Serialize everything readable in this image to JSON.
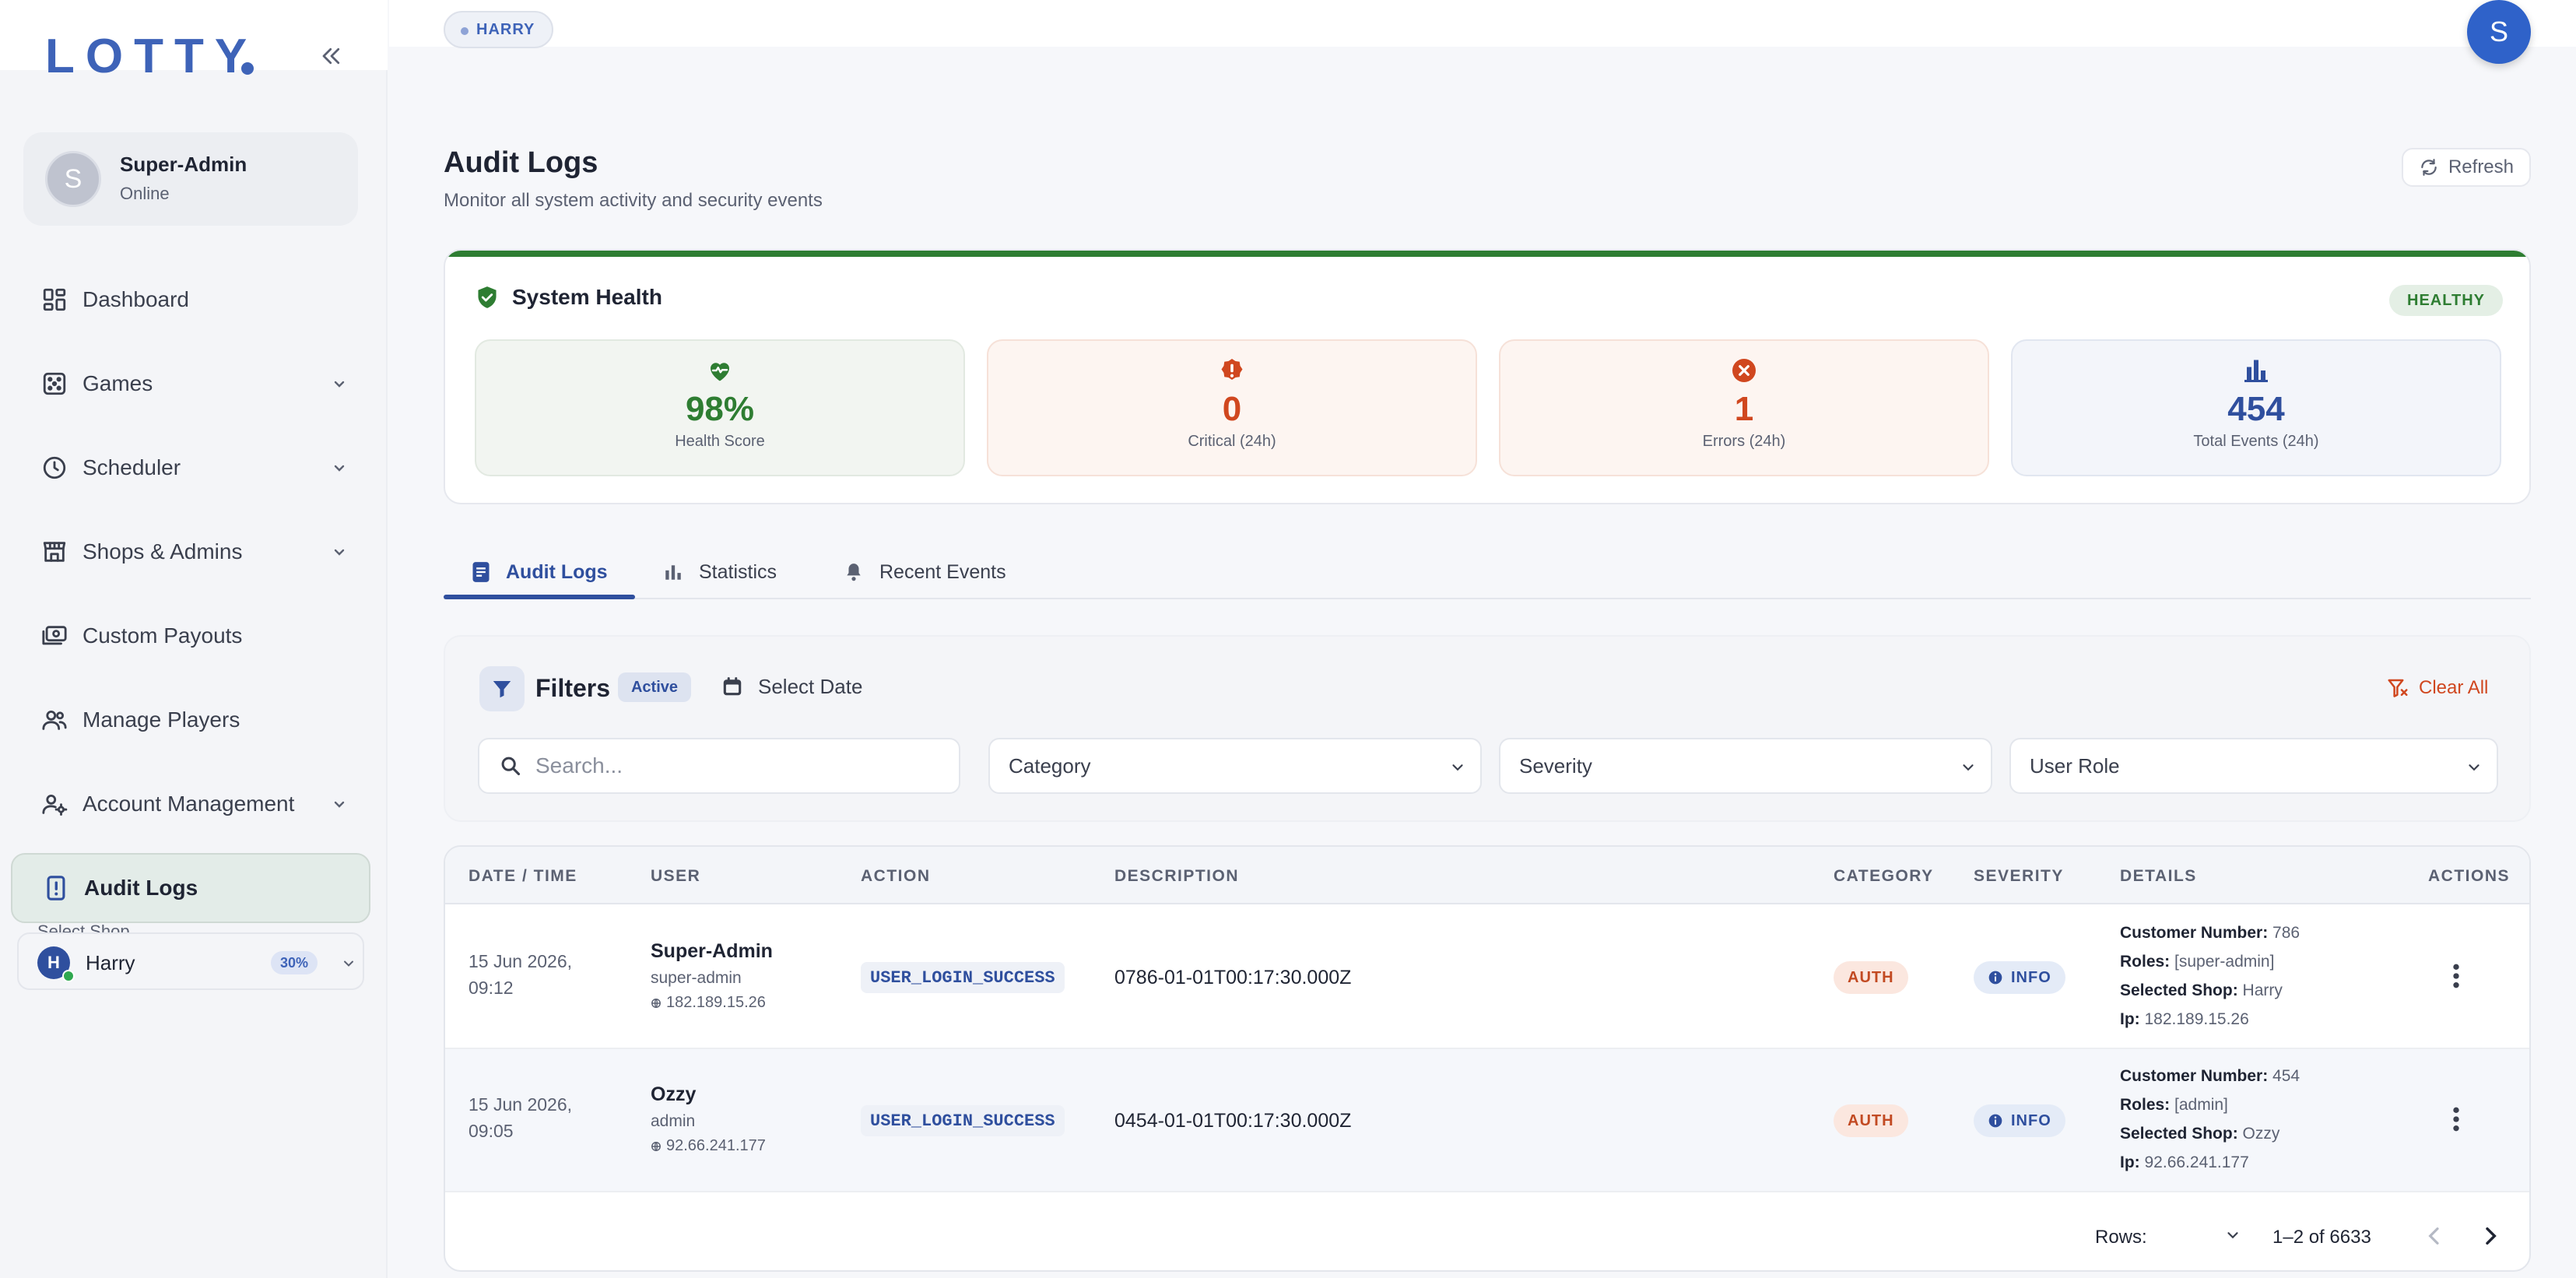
{
  "app": {
    "logo": "LOTTY"
  },
  "user_card": {
    "avatar_letter": "S",
    "name": "Super-Admin",
    "status": "Online"
  },
  "sidebar": {
    "items": [
      {
        "label": "Dashboard",
        "icon": "dashboard-icon",
        "has_chevron": false
      },
      {
        "label": "Games",
        "icon": "dice-icon",
        "has_chevron": true
      },
      {
        "label": "Scheduler",
        "icon": "clock-icon",
        "has_chevron": true
      },
      {
        "label": "Shops & Admins",
        "icon": "store-icon",
        "has_chevron": true
      },
      {
        "label": "Custom Payouts",
        "icon": "money-icon",
        "has_chevron": false
      },
      {
        "label": "Manage Players",
        "icon": "people-icon",
        "has_chevron": false
      },
      {
        "label": "Account Management",
        "icon": "user-gear-icon",
        "has_chevron": true
      },
      {
        "label": "Audit Logs",
        "icon": "audit-icon",
        "has_chevron": false,
        "active": true
      }
    ],
    "shop": {
      "label": "Select Shop",
      "avatar_letter": "H",
      "name": "Harry",
      "percent": "30%"
    }
  },
  "topbar": {
    "shop_chip": "HARRY",
    "avatar_letter": "S"
  },
  "header": {
    "title": "Audit Logs",
    "subtitle": "Monitor all system activity and security events",
    "refresh_label": "Refresh"
  },
  "health": {
    "title": "System Health",
    "status": "HEALTHY",
    "stats": [
      {
        "value": "98%",
        "label": "Health Score",
        "color": "#2e7d32",
        "bg": "#f2f5f1",
        "border": "#e2e9e1",
        "icon": "heart-pulse-icon"
      },
      {
        "value": "0",
        "label": "Critical (24h)",
        "color": "#d0471f",
        "bg": "#fdf5f1",
        "border": "#f6e1d8",
        "icon": "alert-icon"
      },
      {
        "value": "1",
        "label": "Errors (24h)",
        "color": "#d0471f",
        "bg": "#fdf5f1",
        "border": "#f6e1d8",
        "icon": "error-icon"
      },
      {
        "value": "454",
        "label": "Total Events (24h)",
        "color": "#2f4f9e",
        "bg": "#f3f5fa",
        "border": "#e1e6f0",
        "icon": "bar-chart-icon"
      }
    ]
  },
  "tabs": [
    {
      "label": "Audit Logs",
      "icon": "doc-icon",
      "active": true
    },
    {
      "label": "Statistics",
      "icon": "stats-icon",
      "active": false
    },
    {
      "label": "Recent Events",
      "icon": "bell-icon",
      "active": false
    }
  ],
  "filters": {
    "title": "Filters",
    "active_label": "Active",
    "select_date": "Select Date",
    "clear_all": "Clear All",
    "search_placeholder": "Search...",
    "category": "Category",
    "severity": "Severity",
    "user_role": "User Role"
  },
  "table": {
    "columns": [
      "DATE / TIME",
      "USER",
      "ACTION",
      "DESCRIPTION",
      "CATEGORY",
      "SEVERITY",
      "DETAILS",
      "ACTIONS"
    ],
    "rows": [
      {
        "date": "15 Jun 2026,",
        "time": "09:12",
        "user": "Super-Admin",
        "role": "super-admin",
        "ip": "182.189.15.26",
        "action": "USER_LOGIN_SUCCESS",
        "description": "0786-01-01T00:17:30.000Z",
        "category": "AUTH",
        "severity": "INFO",
        "details": {
          "customer_number": "786",
          "roles": "[super-admin]",
          "selected_shop": "Harry",
          "ip": "182.189.15.26"
        }
      },
      {
        "date": "15 Jun 2026,",
        "time": "09:05",
        "user": "Ozzy",
        "role": "admin",
        "ip": "92.66.241.177",
        "action": "USER_LOGIN_SUCCESS",
        "description": "0454-01-01T00:17:30.000Z",
        "category": "AUTH",
        "severity": "INFO",
        "details": {
          "customer_number": "454",
          "roles": "[admin]",
          "selected_shop": "Ozzy",
          "ip": "92.66.241.177"
        }
      }
    ],
    "detail_labels": {
      "customer_number": "Customer Number:",
      "roles": "Roles:",
      "selected_shop": "Selected Shop:",
      "ip": "Ip:"
    },
    "footer": {
      "rows_label": "Rows:",
      "range": "1–2 of 6633"
    }
  }
}
